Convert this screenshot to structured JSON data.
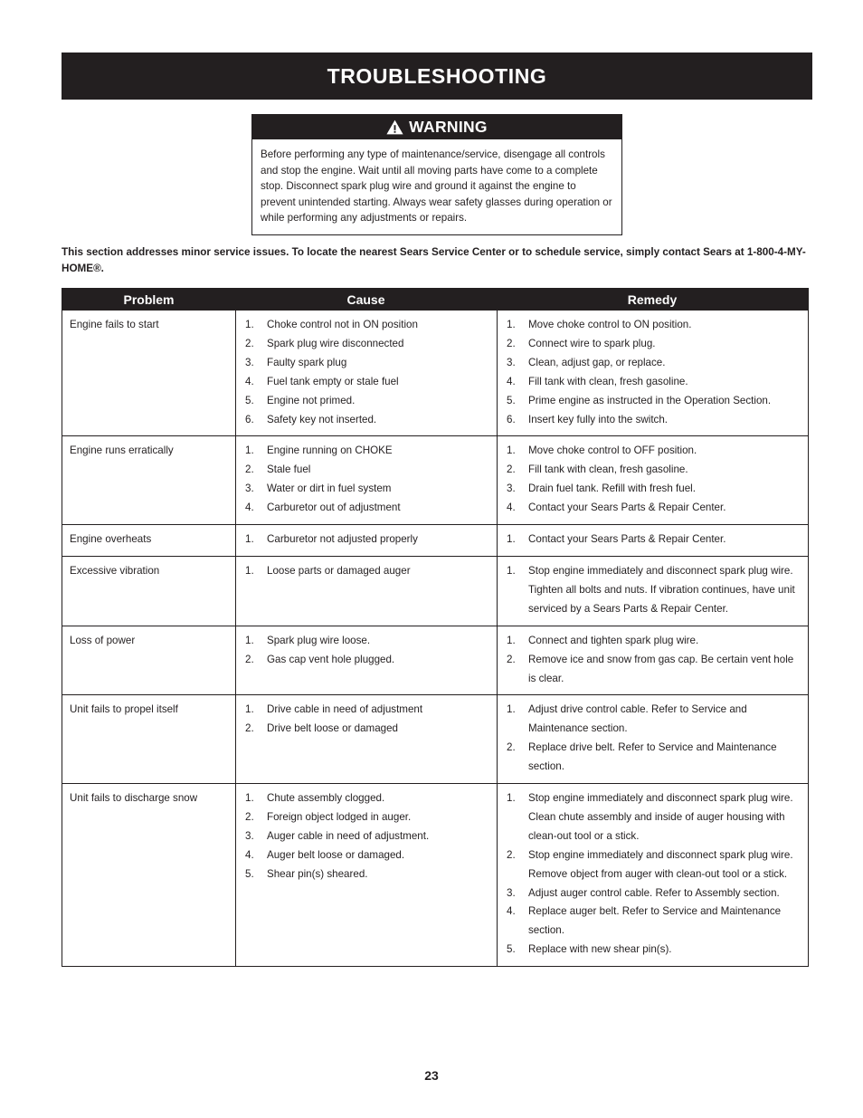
{
  "document": {
    "section_title": "TROUBLESHOOTING",
    "page_number": "23"
  },
  "warning": {
    "icon": "warning-triangle-icon",
    "label": "WARNING",
    "body": "Before performing any type of maintenance/service, disengage all controls and stop the engine. Wait until all moving parts have come to a complete stop. Disconnect spark plug wire and ground it against the engine to prevent unintended starting. Always wear safety glasses during operation or while performing any adjustments or repairs.",
    "header_bg": "#231f20",
    "text_color": "#ffffff"
  },
  "intro": {
    "text": "This section addresses minor service issues. To locate the nearest Sears Service Center or to schedule service, simply contact Sears at 1-800-4-MY-HOME®."
  },
  "table": {
    "header_bg": "#231f20",
    "columns": [
      "Problem",
      "Cause",
      "Remedy"
    ],
    "rows": [
      {
        "problem": "Engine fails to start",
        "causes": [
          "Choke control not in ON position",
          "Spark plug wire disconnected",
          "Faulty spark plug",
          "Fuel tank empty or stale fuel",
          "Engine not primed.",
          "Safety key not inserted."
        ],
        "remedies": [
          "Move choke control to ON position.",
          "Connect wire to spark plug.",
          "Clean, adjust gap, or replace.",
          "Fill tank with clean, fresh gasoline.",
          "Prime engine as instructed in the Operation Section.",
          "Insert key fully into the switch."
        ]
      },
      {
        "problem": "Engine runs erratically",
        "causes": [
          "Engine running on CHOKE",
          "Stale fuel",
          "Water or dirt in fuel system",
          "Carburetor out of adjustment"
        ],
        "remedies": [
          "Move choke control to OFF position.",
          "Fill tank with clean, fresh gasoline.",
          "Drain fuel tank. Refill with fresh fuel.",
          "Contact your Sears Parts & Repair Center."
        ]
      },
      {
        "problem": "Engine overheats",
        "causes": [
          "Carburetor not adjusted properly"
        ],
        "remedies": [
          "Contact your Sears Parts & Repair Center."
        ]
      },
      {
        "problem": "Excessive vibration",
        "causes": [
          "Loose parts or damaged auger"
        ],
        "remedies": [
          "Stop engine immediately and disconnect spark plug wire. Tighten all bolts and nuts. If vibration continues, have unit serviced by a Sears Parts & Repair Center."
        ]
      },
      {
        "problem": "Loss of power",
        "causes": [
          "Spark plug wire loose.",
          "Gas cap vent hole plugged."
        ],
        "remedies": [
          "Connect and tighten spark plug wire.",
          "Remove ice and snow from gas cap. Be certain vent hole is clear."
        ]
      },
      {
        "problem": "Unit fails to propel itself",
        "causes": [
          "Drive cable in need of adjustment",
          "Drive belt loose or damaged"
        ],
        "remedies": [
          "Adjust drive control cable. Refer to Service and Maintenance section.",
          "Replace drive belt. Refer to Service and Maintenance section."
        ]
      },
      {
        "problem": "Unit fails to discharge snow",
        "causes": [
          "Chute assembly clogged.",
          "Foreign object lodged in auger.",
          "Auger cable in need of adjustment.",
          "Auger belt loose or damaged.",
          "Shear pin(s) sheared."
        ],
        "remedies": [
          "Stop engine immediately and disconnect spark plug wire. Clean chute assembly and inside of auger housing with clean-out tool or a stick.",
          "Stop engine immediately and disconnect spark plug wire. Remove object from auger with clean-out tool or a stick.",
          "Adjust auger control cable. Refer to Assembly section.",
          "Replace auger belt. Refer to Service and Maintenance section.",
          "Replace with new shear pin(s)."
        ]
      }
    ]
  }
}
